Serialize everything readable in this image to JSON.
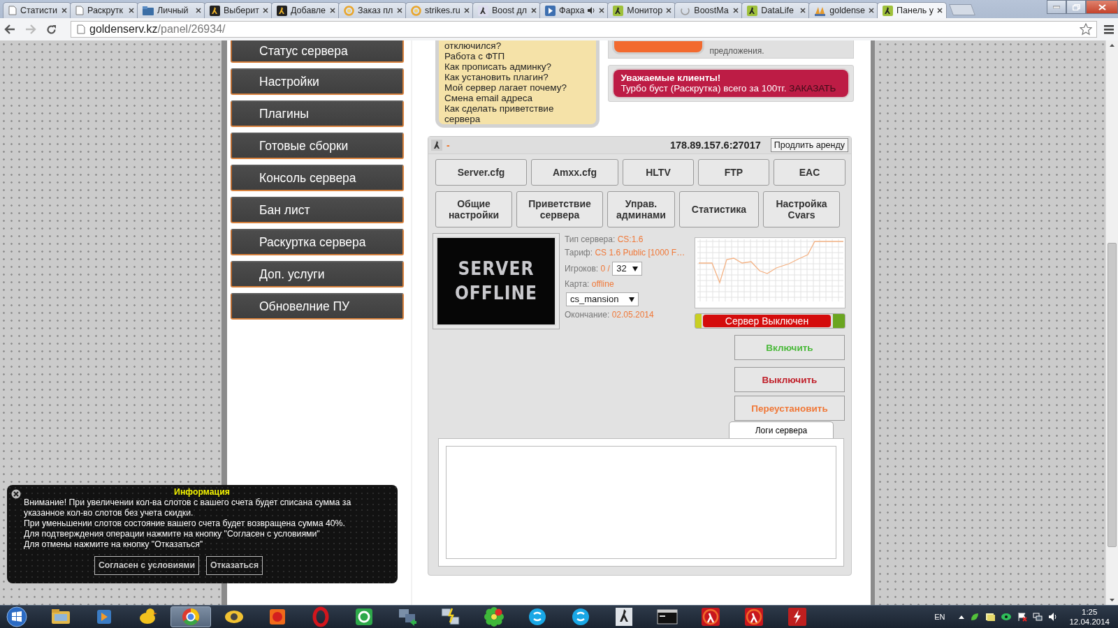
{
  "browser": {
    "tabs": [
      {
        "title": "Статисти",
        "kind": "page",
        "audio": false,
        "selected": false
      },
      {
        "title": "Раскрутк",
        "kind": "page",
        "audio": false,
        "selected": false
      },
      {
        "title": "Личный",
        "kind": "folder",
        "audio": false,
        "selected": false
      },
      {
        "title": "Выберит",
        "kind": "soldier",
        "audio": false,
        "selected": false
      },
      {
        "title": "Добавле",
        "kind": "soldier",
        "audio": false,
        "selected": false
      },
      {
        "title": "Заказ пл",
        "kind": "ring",
        "audio": false,
        "selected": false
      },
      {
        "title": "strikes.ru",
        "kind": "ring",
        "audio": false,
        "selected": false
      },
      {
        "title": "Boost дл",
        "kind": "runner",
        "audio": false,
        "selected": false
      },
      {
        "title": "Фарха",
        "kind": "play",
        "audio": true,
        "selected": false
      },
      {
        "title": "Монитор",
        "kind": "green-soldier",
        "audio": false,
        "selected": false
      },
      {
        "title": "BoostMa",
        "kind": "loading",
        "audio": false,
        "selected": false
      },
      {
        "title": "DataLife",
        "kind": "green-soldier",
        "audio": false,
        "selected": false
      },
      {
        "title": "goldense",
        "kind": "sails",
        "audio": false,
        "selected": false
      },
      {
        "title": "Панель у",
        "kind": "green-soldier",
        "audio": false,
        "selected": true
      }
    ],
    "address": {
      "host": "goldenserv.kz",
      "path": "/panel/26934/"
    }
  },
  "sidebar": {
    "items": [
      {
        "label": "Статус сервера"
      },
      {
        "label": "Настройки"
      },
      {
        "label": "Плагины"
      },
      {
        "label": "Готовые сборки"
      },
      {
        "label": "Консоль сервера"
      },
      {
        "label": "Бан лист"
      },
      {
        "label": "Раскуртка сервера"
      },
      {
        "label": "Доп. услуги"
      },
      {
        "label": "Обновелние ПУ"
      }
    ]
  },
  "faq": {
    "items": [
      "отключился?",
      "Работа с ФТП",
      "Как прописать админку?",
      "Как установить плагин?",
      "Мой сервер лагает почему?",
      "Смена email адреса",
      "Как сделать приветствие сервера"
    ]
  },
  "feedback_card": {
    "text": "предложения."
  },
  "promo": {
    "title": "Уважаемые клиенты!",
    "text": "Турбо буст (Раскрутка) всего за 100тг.",
    "link": "ЗАКАЗАТЬ"
  },
  "server": {
    "name": "-",
    "address": "178.89.157.6:27017",
    "renew_button": "Продлить аренду",
    "config_buttons": [
      "Server.cfg",
      "Amxx.cfg",
      "HLTV",
      "FTP",
      "EAC"
    ],
    "settings_buttons": [
      "Общие настройки",
      "Приветствие сервера",
      "Управ. админами",
      "Статистика",
      "Настройка Cvars"
    ],
    "banner": {
      "line_1": "SERVER",
      "line_2": "OFFLINE"
    },
    "info": {
      "type_label": "Тип сервера:",
      "type_value": "CS:1.6",
      "tariff_label": "Тариф:",
      "tariff_value": "CS 1.6 Public [1000 F…",
      "players_label": "Игроков:",
      "players_value": "0 /",
      "slots": "32",
      "map_label": "Карта:",
      "map_value": "offline",
      "map_select": "cs_mansion",
      "end_label": "Окончание:",
      "end_value": "02.05.2014"
    },
    "status": {
      "text": "Сервер Выключен",
      "on": false
    },
    "actions": [
      {
        "label": "Включить",
        "kind": "start"
      },
      {
        "label": "Выключить",
        "kind": "stop"
      },
      {
        "label": "Переустановить",
        "kind": "reinstall"
      }
    ],
    "logs_tab": "Логи сервера"
  },
  "popup": {
    "title": "Информация",
    "lines": [
      "Внимание! При увеличении кол-ва слотов с вашего счета будет списана сумма за указанное кол-во слотов без учета скидки.",
      "При уменьшении слотов состояние вашего счета будет возвращена сумма 40%.",
      "Для подтверждения операции нажмите на кнопку \"Согласен с условиями\"",
      "Для отмены нажмите на кнопку \"Отказаться\""
    ],
    "buttons": [
      "Согласен с условиями",
      "Отказаться"
    ]
  },
  "taskbar": {
    "apps": [
      {
        "kind": "folder",
        "selected": false
      },
      {
        "kind": "media",
        "selected": false
      },
      {
        "kind": "duck",
        "selected": false
      },
      {
        "kind": "wheel",
        "selected": true
      },
      {
        "kind": "eye",
        "selected": false
      },
      {
        "kind": "game",
        "selected": false
      },
      {
        "kind": "ring",
        "selected": false
      },
      {
        "kind": "mail",
        "selected": false
      },
      {
        "kind": "network",
        "selected": false
      },
      {
        "kind": "link",
        "selected": false
      },
      {
        "kind": "flower",
        "selected": false
      },
      {
        "kind": "chat",
        "selected": false
      },
      {
        "kind": "chat",
        "selected": false
      },
      {
        "kind": "soldier",
        "selected": false
      },
      {
        "kind": "console",
        "selected": false
      },
      {
        "kind": "disc",
        "selected": false
      },
      {
        "kind": "disc",
        "selected": false
      },
      {
        "kind": "bolt",
        "selected": false
      }
    ],
    "language": "EN",
    "time": "1:25",
    "date": "12.04.2014"
  }
}
